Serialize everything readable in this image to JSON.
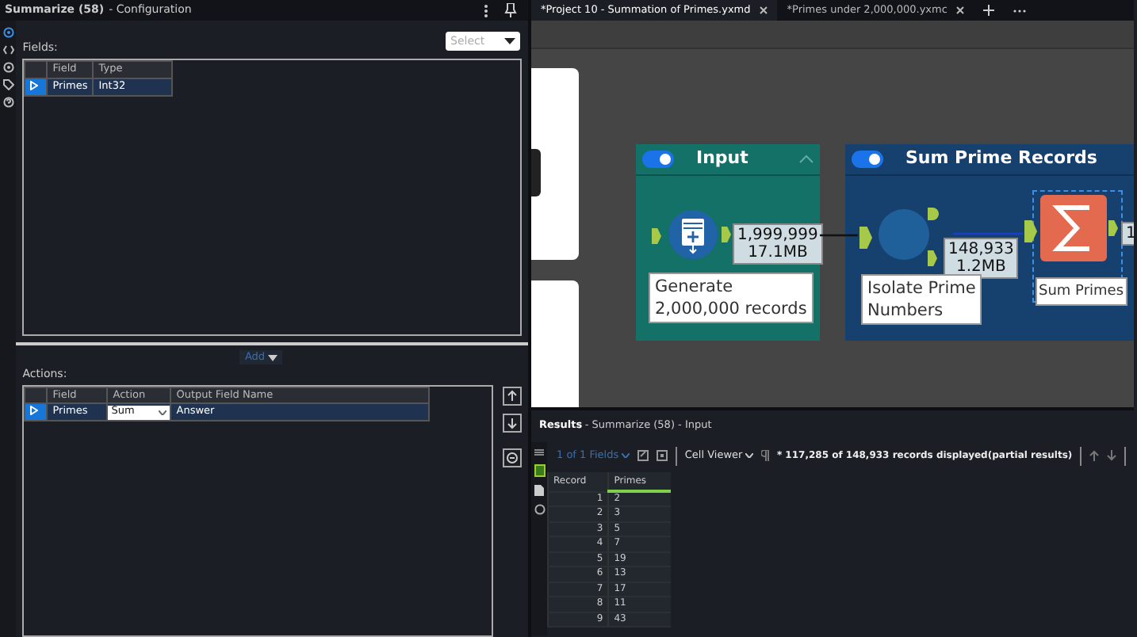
{
  "config_panel": {
    "title": "Summarize (58)",
    "subtitle": "- Configuration",
    "fields_label": "Fields:",
    "select_placeholder": "Select",
    "fields_table": {
      "columns": [
        "Field",
        "Type"
      ],
      "rows": [
        {
          "cells": [
            "Primes",
            "Int32"
          ],
          "selected": true
        }
      ]
    },
    "add_button": "Add",
    "actions_label": "Actions:",
    "actions_table": {
      "columns": [
        "Field",
        "Action",
        "Output Field Name"
      ],
      "rows": [
        {
          "field": "Primes",
          "action": "Sum",
          "output": "Answer",
          "selected": true
        }
      ]
    }
  },
  "tabs": [
    {
      "label": "*Project 10 - Summation of Primes.yxmd",
      "selected": true
    },
    {
      "label": "*Primes under 2,000,000.yxmc",
      "selected": false
    }
  ],
  "canvas": {
    "containers": [
      {
        "title": "Input",
        "enabled": true,
        "collapsible": true,
        "color": "#137168",
        "tools": [
          {
            "kind": "generate",
            "label": "Generate\n2,000,000 records",
            "output": [
              "1,999,999",
              "17.1MB"
            ]
          }
        ]
      },
      {
        "title": "Sum Prime Records",
        "enabled": true,
        "collapsible": false,
        "color": "#16406e",
        "tools": [
          {
            "kind": "filter",
            "label": "Isolate Prime\nNumbers",
            "output": [
              "148,933",
              "1.2MB"
            ]
          },
          {
            "kind": "summarize",
            "label": "Sum Primes",
            "output": [
              "1"
            ],
            "selected": true
          }
        ]
      }
    ]
  },
  "results": {
    "title": "Results",
    "subtitle": "- Summarize (58) - Input",
    "fields": "1 of 1 Fields",
    "viewer": "Cell Viewer",
    "message": "* 117,285 of 148,933 records displayed(partial results)",
    "columns": [
      "Record",
      "Primes"
    ],
    "rows": [
      [
        "1",
        "2"
      ],
      [
        "2",
        "3"
      ],
      [
        "3",
        "5"
      ],
      [
        "4",
        "7"
      ],
      [
        "5",
        "19"
      ],
      [
        "6",
        "13"
      ],
      [
        "7",
        "17"
      ],
      [
        "8",
        "11"
      ],
      [
        "9",
        "43"
      ]
    ]
  }
}
